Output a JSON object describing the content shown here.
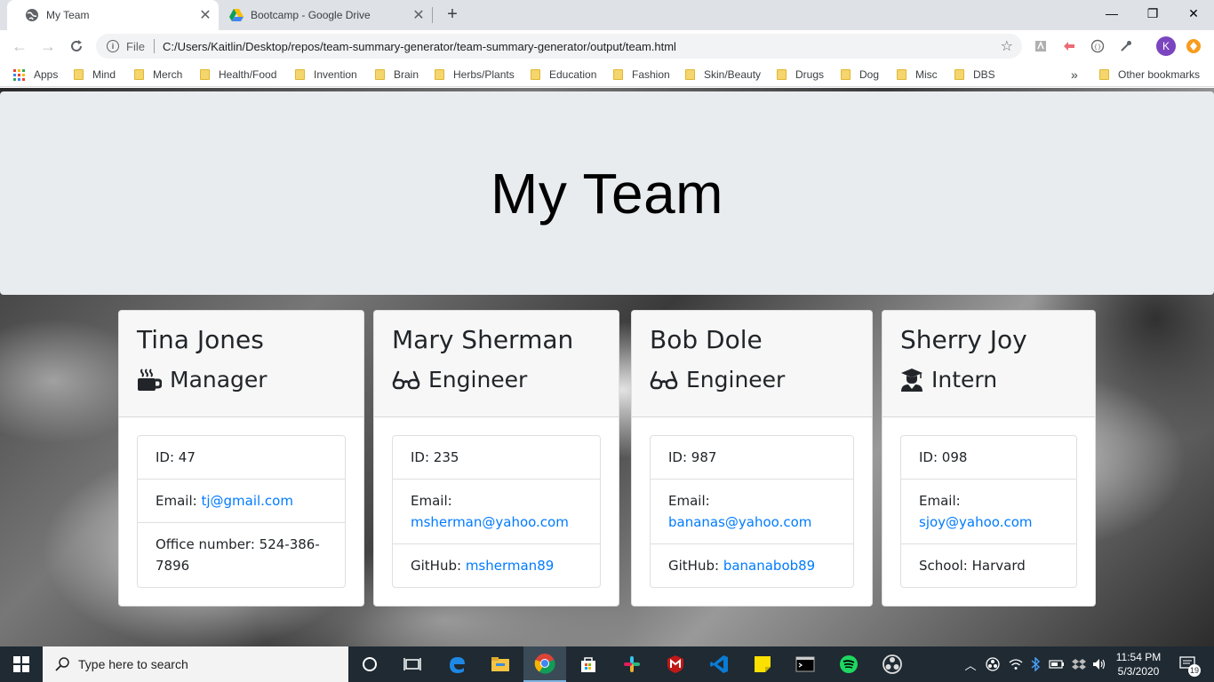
{
  "browser": {
    "tabs": [
      {
        "title": "My Team",
        "active": true
      },
      {
        "title": "Bootcamp - Google Drive",
        "active": false
      }
    ],
    "new_tab": "+",
    "window_controls": {
      "minimize": "—",
      "restore": "❐",
      "close": "✕"
    },
    "address": {
      "scheme": "File",
      "url": "C:/Users/Kaitlin/Desktop/repos/team-summary-generator/team-summary-generator/output/team.html"
    },
    "profile_initial": "K",
    "bookmarks": {
      "apps_label": "Apps",
      "folders": [
        "Mind",
        "Merch",
        "Health/Food",
        "Invention",
        "Brain",
        "Herbs/Plants",
        "Education",
        "Fashion",
        "Skin/Beauty",
        "Drugs",
        "Dog",
        "Misc",
        "DBS"
      ],
      "overflow": "»",
      "other": "Other bookmarks"
    }
  },
  "page": {
    "title": "My Team",
    "members": [
      {
        "name": "Tina Jones",
        "role": "Manager",
        "icon": "mug-icon",
        "id_label": "ID: ",
        "id": "47",
        "email_label": "Email: ",
        "email": "tj@gmail.com",
        "extra_label": "Office number: ",
        "extra_value": "524-386-7896"
      },
      {
        "name": "Mary Sherman",
        "role": "Engineer",
        "icon": "glasses-icon",
        "id_label": "ID: ",
        "id": "235",
        "email_label": "Email:",
        "email": "msherman@yahoo.com",
        "extra_label": "GitHub: ",
        "extra_value": "msherman89"
      },
      {
        "name": "Bob Dole",
        "role": "Engineer",
        "icon": "glasses-icon",
        "id_label": "ID: ",
        "id": "987",
        "email_label": "Email:",
        "email": "bananas@yahoo.com",
        "extra_label": "GitHub: ",
        "extra_value": "bananabob89"
      },
      {
        "name": "Sherry Joy",
        "role": "Intern",
        "icon": "graduate-icon",
        "id_label": "ID: ",
        "id": "098",
        "email_label": "Email:",
        "email": "sjoy@yahoo.com",
        "extra_label": "School: ",
        "extra_value": "Harvard"
      }
    ]
  },
  "taskbar": {
    "search_placeholder": "Type here to search",
    "time": "11:54 PM",
    "date": "5/3/2020",
    "notifications": "19"
  },
  "colors": {
    "link": "#007bff",
    "jumbotron_bg": "#e9ecef",
    "taskbar_bg": "#1f2a33"
  }
}
